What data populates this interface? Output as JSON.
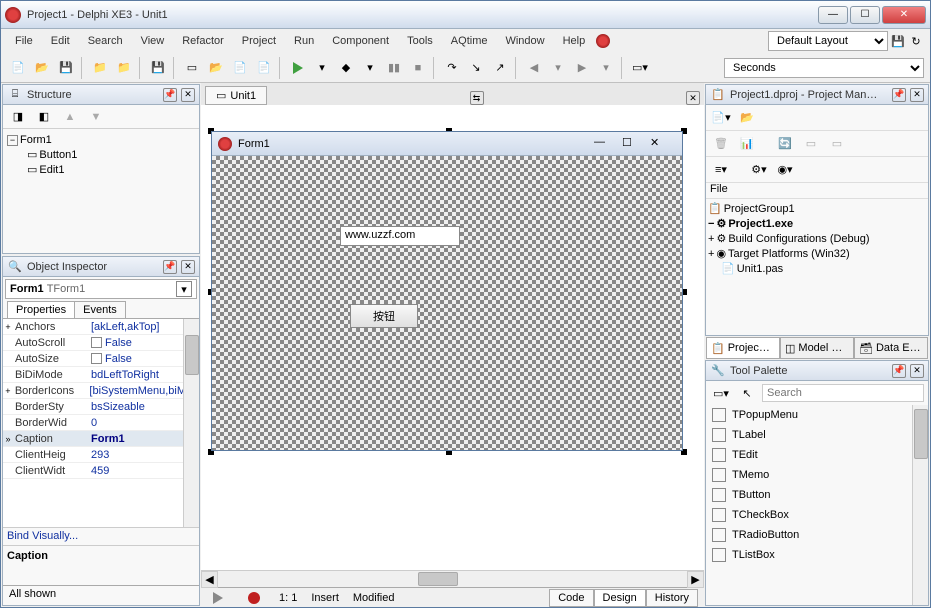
{
  "titlebar": {
    "title": "Project1 - Delphi XE3 - Unit1"
  },
  "menu": {
    "items": [
      "File",
      "Edit",
      "Search",
      "View",
      "Refactor",
      "Project",
      "Run",
      "Component",
      "Tools",
      "AQtime",
      "Window",
      "Help"
    ],
    "layout": "Default Layout",
    "seconds": "Seconds"
  },
  "structure": {
    "title": "Structure",
    "root": "Form1",
    "children": [
      "Button1",
      "Edit1"
    ]
  },
  "oi": {
    "title": "Object Inspector",
    "selector_name": "Form1",
    "selector_type": "TForm1",
    "tabs": [
      "Properties",
      "Events"
    ],
    "props": [
      {
        "n": "Anchors",
        "v": "[akLeft,akTop]",
        "exp": "+"
      },
      {
        "n": "AutoScroll",
        "v": "False",
        "cb": true
      },
      {
        "n": "AutoSize",
        "v": "False",
        "cb": true
      },
      {
        "n": "BiDiMode",
        "v": "bdLeftToRight"
      },
      {
        "n": "BorderIcons",
        "v": "[biSystemMenu,biMini",
        "exp": "+",
        "trunc": true
      },
      {
        "n": "BorderStyle",
        "v": "bsSizeable",
        "trunc": "BorderSty"
      },
      {
        "n": "BorderWidth",
        "v": "0",
        "trunc": "BorderWid"
      },
      {
        "n": "Caption",
        "v": "Form1",
        "sel": true
      },
      {
        "n": "ClientHeight",
        "v": "293",
        "trunc": "ClientHeig"
      },
      {
        "n": "ClientWidth",
        "v": "459",
        "trunc": "ClientWidt"
      }
    ],
    "bind_link": "Bind Visually...",
    "help": "Caption",
    "status": "All shown"
  },
  "center": {
    "tab": "Unit1",
    "form_caption": "Form1",
    "edit_text": "www.uzzf.com",
    "button_text": "按钮",
    "status_ratio": "1: 1",
    "status_insert": "Insert",
    "status_modified": "Modified",
    "view_tabs": [
      "Code",
      "Design",
      "History"
    ]
  },
  "pm": {
    "title": "Project1.dproj - Project Man…",
    "file_label": "File",
    "group": "ProjectGroup1",
    "exe": "Project1.exe",
    "build": "Build Configurations (Debug)",
    "target": "Target Platforms (Win32)",
    "unit": "Unit1.pas",
    "tabs": [
      "Projec…",
      "Model …",
      "Data E…"
    ]
  },
  "tp": {
    "title": "Tool Palette",
    "search_ph": "Search",
    "items": [
      "TPopupMenu",
      "TLabel",
      "TEdit",
      "TMemo",
      "TButton",
      "TCheckBox",
      "TRadioButton",
      "TListBox"
    ]
  }
}
